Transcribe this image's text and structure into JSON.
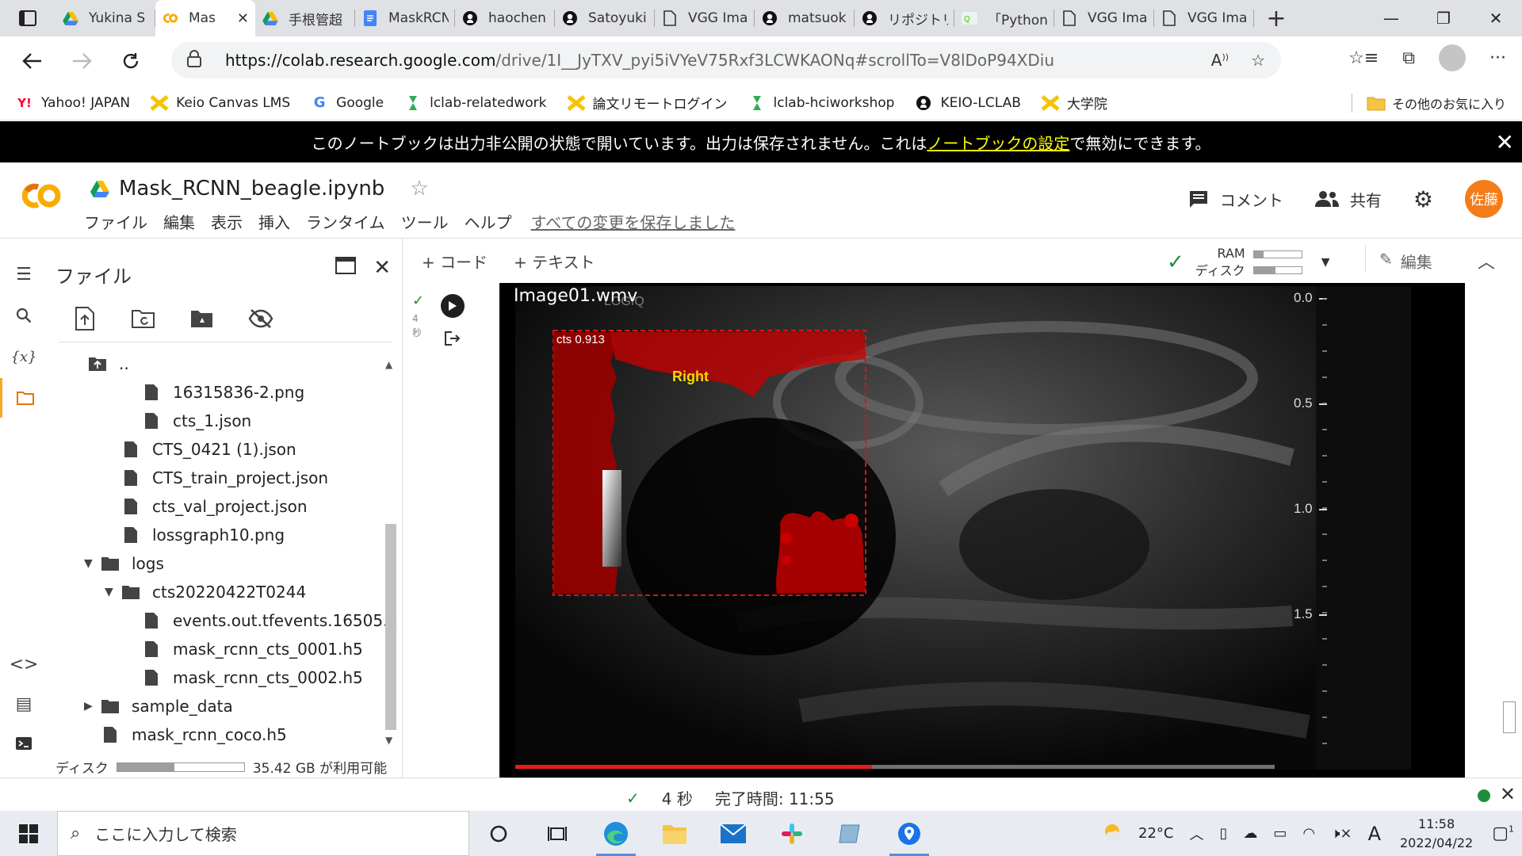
{
  "browser": {
    "tabs": [
      {
        "label": "Yukina S",
        "icon": "google-drive-icon",
        "active": false
      },
      {
        "label": "Mas",
        "icon": "colab-icon",
        "active": true
      },
      {
        "label": "手根管超",
        "icon": "google-drive-icon",
        "active": false
      },
      {
        "label": "MaskRCN",
        "icon": "google-docs-icon",
        "active": false
      },
      {
        "label": "haochen",
        "icon": "github-icon",
        "active": false
      },
      {
        "label": "Satoyuki",
        "icon": "github-icon",
        "active": false
      },
      {
        "label": "VGG Ima",
        "icon": "page-icon",
        "active": false
      },
      {
        "label": "matsuok",
        "icon": "github-icon",
        "active": false
      },
      {
        "label": "リポジトリ",
        "icon": "github-icon",
        "active": false
      },
      {
        "label": "「Python",
        "icon": "qiita-icon",
        "active": false
      },
      {
        "label": "VGG Ima",
        "icon": "page-icon",
        "active": false
      },
      {
        "label": "VGG Ima",
        "icon": "page-icon",
        "active": false
      }
    ],
    "url_base": "https://colab.research.google.com",
    "url_rest": "/drive/1I__JyTXV_pyi5iVYeV75Rxf3LCWKAONq#scrollTo=V8lDoP94XDiu",
    "bookmarks": [
      {
        "label": "Yahoo! JAPAN",
        "icon": "yahoo-icon"
      },
      {
        "label": "Keio Canvas LMS",
        "icon": "keio-icon"
      },
      {
        "label": "Google",
        "icon": "google-icon"
      },
      {
        "label": "lclab-relatedwork",
        "icon": "scrapbox-icon"
      },
      {
        "label": "論文リモートログイン",
        "icon": "keio-icon"
      },
      {
        "label": "lclab-hciworkshop",
        "icon": "scrapbox-icon"
      },
      {
        "label": "KEIO-LCLAB",
        "icon": "github-icon"
      },
      {
        "label": "大学院",
        "icon": "keio-icon"
      }
    ],
    "other_bookmarks": "その他のお気に入り"
  },
  "banner": {
    "text_before": "このノートブックは出力非公開の状態で開いています。出力は保存されません。これは",
    "link": "ノートブックの設定",
    "text_after": "で無効にできます。"
  },
  "colab": {
    "logo": "CO",
    "notebook_name": "Mask_RCNN_beagle.ipynb",
    "menu": [
      "ファイル",
      "編集",
      "表示",
      "挿入",
      "ランタイム",
      "ツール",
      "ヘルプ"
    ],
    "saved_status": "すべての変更を保存しました",
    "comment_label": "コメント",
    "share_label": "共有",
    "user_initials": "佐藤",
    "add_code": "+ コード",
    "add_text": "+ テキスト",
    "ram_label": "RAM",
    "disk_label": "ディスク",
    "ram_fraction": 0.2,
    "disk_fraction": 0.45,
    "edit_label": "編集"
  },
  "files": {
    "title": "ファイル",
    "tree": [
      {
        "name": "..",
        "type": "parent",
        "indent": 0,
        "arrow": ""
      },
      {
        "name": "16315836-2.png",
        "type": "file",
        "indent": 3,
        "arrow": ""
      },
      {
        "name": "cts_1.json",
        "type": "file",
        "indent": 3,
        "arrow": ""
      },
      {
        "name": "CTS_0421 (1).json",
        "type": "file",
        "indent": 2,
        "arrow": ""
      },
      {
        "name": "CTS_train_project.json",
        "type": "file",
        "indent": 2,
        "arrow": ""
      },
      {
        "name": "cts_val_project.json",
        "type": "file",
        "indent": 2,
        "arrow": ""
      },
      {
        "name": "lossgraph10.png",
        "type": "file",
        "indent": 2,
        "arrow": ""
      },
      {
        "name": "logs",
        "type": "folder",
        "indent": 1,
        "arrow": "▼"
      },
      {
        "name": "cts20220422T0244",
        "type": "folder",
        "indent": 2,
        "arrow": "▼"
      },
      {
        "name": "events.out.tfevents.16505...",
        "type": "file",
        "indent": 3,
        "arrow": ""
      },
      {
        "name": "mask_rcnn_cts_0001.h5",
        "type": "file",
        "indent": 3,
        "arrow": ""
      },
      {
        "name": "mask_rcnn_cts_0002.h5",
        "type": "file",
        "indent": 3,
        "arrow": ""
      },
      {
        "name": "sample_data",
        "type": "folder",
        "indent": 1,
        "arrow": "▶"
      },
      {
        "name": "mask_rcnn_coco.h5",
        "type": "file",
        "indent": 1,
        "arrow": ""
      }
    ],
    "disk_label": "ディスク",
    "disk_fraction": 0.45,
    "disk_available": "35.42 GB が利用可能"
  },
  "cell": {
    "exec_time": "4",
    "exec_unit": "秒",
    "video_title": "Image01.wmv",
    "watermark": "LOGIQ",
    "detection_label": "cts 0.913",
    "overlay_text": "Right",
    "depth_ticks": [
      "0.0",
      "0.5",
      "1.0",
      "1.5"
    ],
    "playback_fraction": 0.47
  },
  "statusbar": {
    "elapsed": "4 秒",
    "completed": "完了時間: 11:55"
  },
  "taskbar": {
    "search_placeholder": "ここに入力して検索",
    "weather": "22°C",
    "time": "11:58",
    "date": "2022/04/22",
    "ime": "A",
    "notification_count": "1"
  },
  "colors": {
    "colab_orange": "#f9ab00",
    "user_avatar": "#f47c19",
    "detection_red": "#d40000",
    "success_green": "#1e8e3e"
  }
}
